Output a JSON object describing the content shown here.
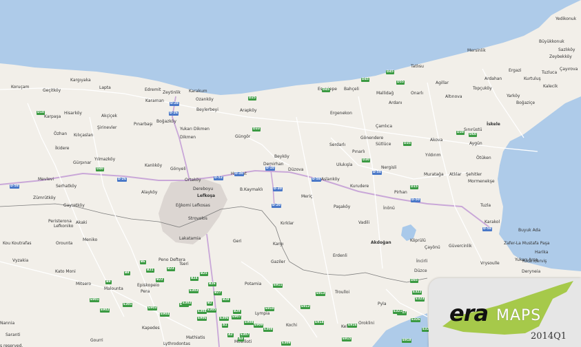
{
  "colors": {
    "sea": "#aecbe9",
    "land": "#f2efe9",
    "motorway": "#c9a7d8",
    "road": "#ffffff",
    "urban": "#dcd6d2",
    "border": "#7a7a7a",
    "lake": "#a9c9ea",
    "logo_green": "#a6c94a"
  },
  "places": [
    {
      "name": "Yedikonuk",
      "bold": false
    },
    {
      "name": "Büyükkonuk",
      "bold": false
    },
    {
      "name": "Sazlıköy",
      "bold": false
    },
    {
      "name": "Zeybekköy",
      "bold": false
    },
    {
      "name": "Tuzluca",
      "bold": false
    },
    {
      "name": "Çayırova",
      "bold": false
    },
    {
      "name": "Kalecik",
      "bold": false
    },
    {
      "name": "Mersinlik",
      "bold": false
    },
    {
      "name": "Ergazi",
      "bold": false
    },
    {
      "name": "Kurtuluş",
      "bold": false
    },
    {
      "name": "Ardahan",
      "bold": false
    },
    {
      "name": "Topçuköy",
      "bold": false
    },
    {
      "name": "Yarköy",
      "bold": false
    },
    {
      "name": "Boğaziçe",
      "bold": false
    },
    {
      "name": "Tatlısu",
      "bold": false
    },
    {
      "name": "Agillar",
      "bold": false
    },
    {
      "name": "Altınova",
      "bold": false
    },
    {
      "name": "Mallidağ",
      "bold": false
    },
    {
      "name": "Onarlı",
      "bold": false
    },
    {
      "name": "Ardanı",
      "bold": false
    },
    {
      "name": "Esentepe",
      "bold": false
    },
    {
      "name": "Bahçeli",
      "bold": false
    },
    {
      "name": "İskele",
      "bold": true
    },
    {
      "name": "Sınırüstü",
      "bold": false
    },
    {
      "name": "Çamlıca",
      "bold": false
    },
    {
      "name": "Gönendere",
      "bold": false
    },
    {
      "name": "Sütlüce",
      "bold": false
    },
    {
      "name": "Akova",
      "bold": false
    },
    {
      "name": "Aygün",
      "bold": false
    },
    {
      "name": "Ergenekon",
      "bold": false
    },
    {
      "name": "Kargıyaka",
      "bold": false
    },
    {
      "name": "Koruçam",
      "bold": false
    },
    {
      "name": "Geçitköy",
      "bold": false
    },
    {
      "name": "Lapta",
      "bold": false
    },
    {
      "name": "Edremit",
      "bold": false
    },
    {
      "name": "Zeytinlik",
      "bold": false
    },
    {
      "name": "Karakum",
      "bold": false
    },
    {
      "name": "Karaman",
      "bold": false
    },
    {
      "name": "Ozanköy",
      "bold": false
    },
    {
      "name": "Beylerbeyi",
      "bold": false
    },
    {
      "name": "Arapköy",
      "bold": false
    },
    {
      "name": "Karpaşa",
      "bold": false
    },
    {
      "name": "Hisarköy",
      "bold": false
    },
    {
      "name": "Akçiçek",
      "bold": false
    },
    {
      "name": "Şirinevler",
      "bold": false
    },
    {
      "name": "Pınarbaşı",
      "bold": false
    },
    {
      "name": "Boğazköy",
      "bold": false
    },
    {
      "name": "Yukarı Dikmen",
      "bold": false
    },
    {
      "name": "Dikmen",
      "bold": false
    },
    {
      "name": "Güngör",
      "bold": false
    },
    {
      "name": "Serdarlı",
      "bold": false
    },
    {
      "name": "Pınarlı",
      "bold": false
    },
    {
      "name": "Özhan",
      "bold": false
    },
    {
      "name": "Kılıçaslan",
      "bold": false
    },
    {
      "name": "İkidere",
      "bold": false
    },
    {
      "name": "Yılmazköy",
      "bold": false
    },
    {
      "name": "Gürpınar",
      "bold": false
    },
    {
      "name": "Kanlıköy",
      "bold": false
    },
    {
      "name": "Gönyeli",
      "bold": false
    },
    {
      "name": "Beyköy",
      "bold": false
    },
    {
      "name": "Demirhan",
      "bold": false
    },
    {
      "name": "Hasplat",
      "bold": false
    },
    {
      "name": "Düzova",
      "bold": false
    },
    {
      "name": "Ulukışla",
      "bold": false
    },
    {
      "name": "Nergisli",
      "bold": false
    },
    {
      "name": "Yıldırım",
      "bold": false
    },
    {
      "name": "Ötüken",
      "bold": false
    },
    {
      "name": "Mevlevi",
      "bold": false
    },
    {
      "name": "Serhatköy",
      "bold": false
    },
    {
      "name": "Alayköy",
      "bold": false
    },
    {
      "name": "Ortaköy",
      "bold": false
    },
    {
      "name": "Dereboyu",
      "bold": false
    },
    {
      "name": "Lefkoşa",
      "bold": true
    },
    {
      "name": "B.Kaymaklı",
      "bold": false
    },
    {
      "name": "Aslanköy",
      "bold": false
    },
    {
      "name": "Kurudere",
      "bold": false
    },
    {
      "name": "Muratağa",
      "bold": false
    },
    {
      "name": "Atlılar",
      "bold": false
    },
    {
      "name": "Şehitler",
      "bold": false
    },
    {
      "name": "Mormenekşe",
      "bold": false
    },
    {
      "name": "Zümrütköy",
      "bold": false
    },
    {
      "name": "Gayretköy",
      "bold": false
    },
    {
      "name": "Eğkomi Lefkosas",
      "bold": false
    },
    {
      "name": "Meriç",
      "bold": false
    },
    {
      "name": "Paşaköy",
      "bold": false
    },
    {
      "name": "Pirhan",
      "bold": false
    },
    {
      "name": "İnönü",
      "bold": false
    },
    {
      "name": "Tuzla",
      "bold": false
    },
    {
      "name": "Peristerona",
      "bold": false
    },
    {
      "name": "Akaki",
      "bold": false
    },
    {
      "name": "Lefkoniko",
      "bold": false
    },
    {
      "name": "Strovolos",
      "bold": false
    },
    {
      "name": "Kırklar",
      "bold": false
    },
    {
      "name": "Vadili",
      "bold": false
    },
    {
      "name": "Karakol",
      "bold": false
    },
    {
      "name": "Buyuk Ada",
      "bold": false
    },
    {
      "name": "Kou Koutrafas",
      "bold": false
    },
    {
      "name": "Orounta",
      "bold": false
    },
    {
      "name": "Meniko",
      "bold": false
    },
    {
      "name": "Lakatamia",
      "bold": false
    },
    {
      "name": "Geri",
      "bold": false
    },
    {
      "name": "Kargı",
      "bold": false
    },
    {
      "name": "Akdoğan",
      "bold": true
    },
    {
      "name": "Köprülü",
      "bold": false
    },
    {
      "name": "Güvercinlik",
      "bold": false
    },
    {
      "name": "Çayönü",
      "bold": false
    },
    {
      "name": "Zafer-La Mustafa Paşa",
      "bold": false
    },
    {
      "name": "Yukarı Arsa",
      "bold": false
    },
    {
      "name": "Peno Deftera",
      "bold": false
    },
    {
      "name": "Erdenli",
      "bold": false
    },
    {
      "name": "Harika",
      "bold": false
    },
    {
      "name": "Vyzakia",
      "bold": false
    },
    {
      "name": "Tseri",
      "bold": false
    },
    {
      "name": "Gaziler",
      "bold": false
    },
    {
      "name": "İncirli",
      "bold": false
    },
    {
      "name": "Yukarıderviş",
      "bold": false
    },
    {
      "name": "Kato Moni",
      "bold": false
    },
    {
      "name": "Vrysoulle",
      "bold": false
    },
    {
      "name": "Düzce",
      "bold": false
    },
    {
      "name": "Deryneia",
      "bold": false
    },
    {
      "name": "Mitsero",
      "bold": false
    },
    {
      "name": "Malounta",
      "bold": false
    },
    {
      "name": "Episkopeio",
      "bold": false
    },
    {
      "name": "Pera",
      "bold": false
    },
    {
      "name": "Potamia",
      "bold": false
    },
    {
      "name": "Troulloi",
      "bold": false
    },
    {
      "name": "Pyla",
      "bold": false
    },
    {
      "name": "Lympia",
      "bold": false
    },
    {
      "name": "Kochi",
      "bold": false
    },
    {
      "name": "Kellia",
      "bold": false
    },
    {
      "name": "Oroklini",
      "bold": false
    },
    {
      "name": "Nannia",
      "bold": false
    },
    {
      "name": "Kapedes",
      "bold": false
    },
    {
      "name": "Saranti",
      "bold": false
    },
    {
      "name": "Mathiatis",
      "bold": false
    },
    {
      "name": "Gourri",
      "bold": false
    },
    {
      "name": "Lythrodontas",
      "bold": false
    },
    {
      "name": "Mosfiloti",
      "bold": false
    },
    {
      "name": "s reserved.",
      "bold": false
    }
  ],
  "shields": [
    "D-58",
    "D-28",
    "D-26",
    "D-52",
    "D-26",
    "D-10",
    "D-58",
    "D-30",
    "D-20",
    "D-30",
    "D-50",
    "D-58",
    "D-50",
    "D45",
    "D25",
    "D15",
    "D35",
    "D38",
    "D33",
    "D45",
    "D45",
    "D30",
    "D60",
    "D55",
    "D85",
    "D10",
    "D40",
    "B6",
    "B8",
    "B9",
    "B21",
    "B22",
    "B23",
    "B24",
    "B25",
    "B26",
    "B27",
    "B28",
    "B29",
    "B2",
    "E901",
    "E902",
    "E903",
    "E904",
    "E905",
    "E906",
    "E907",
    "E908",
    "E909",
    "E910",
    "E911",
    "E912",
    "E913",
    "E914",
    "E915",
    "E916",
    "E917",
    "E918",
    "E301",
    "E302",
    "E303",
    "E304",
    "E305",
    "E306",
    "E307",
    "E308",
    "E309",
    "E321",
    "E322",
    "E323",
    "E324",
    "E325",
    "E326",
    "A1",
    "A2",
    "A3"
  ],
  "logo": {
    "brand": "era",
    "suffix": "MAPS",
    "version": "2014Q1"
  }
}
